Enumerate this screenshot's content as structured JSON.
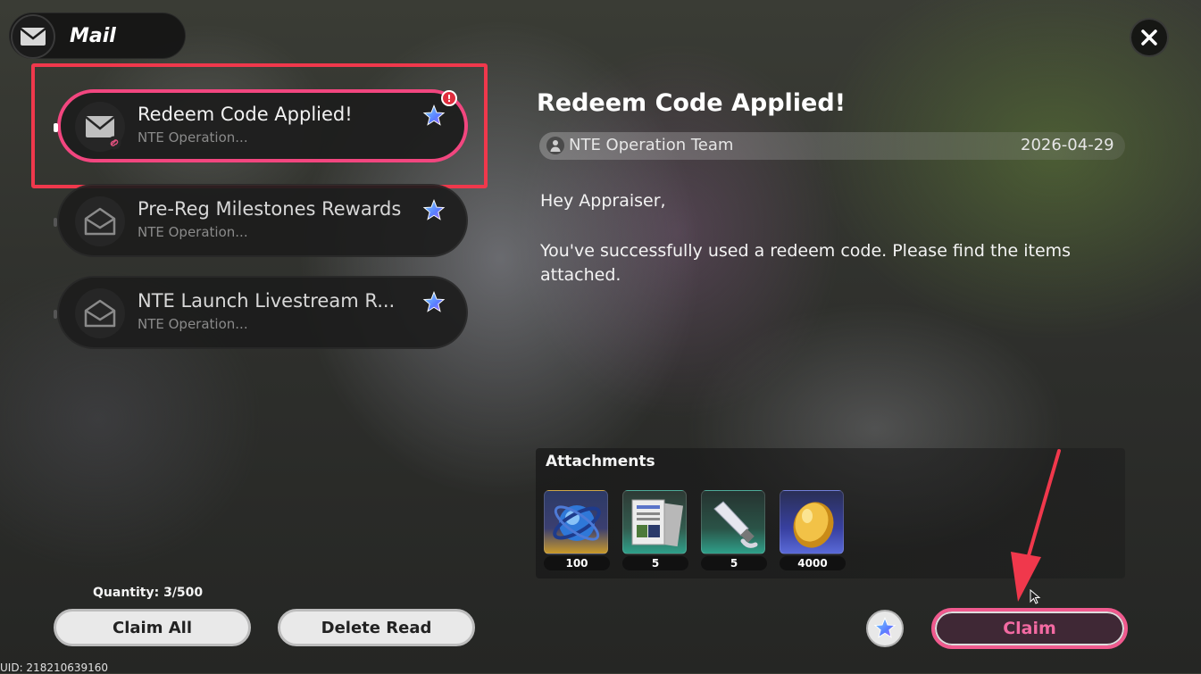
{
  "header": {
    "title": "Mail",
    "icon": "envelope-icon"
  },
  "close": {
    "icon": "close-icon"
  },
  "mail_list": [
    {
      "title": "Redeem Code Applied!",
      "sender": "NTE Operation...",
      "selected": true,
      "unread": true,
      "icon": "envelope-closed-icon",
      "has_link": true
    },
    {
      "title": "Pre-Reg Milestones Rewards",
      "sender": "NTE Operation...",
      "selected": false,
      "unread": false,
      "icon": "envelope-open-icon"
    },
    {
      "title": "NTE Launch Livestream R...",
      "sender": "NTE Operation...",
      "selected": false,
      "unread": false,
      "icon": "envelope-open-icon"
    }
  ],
  "alert_badge": "!",
  "quantity": "Quantity: 3/500",
  "buttons": {
    "claim_all": "Claim All",
    "delete_read": "Delete Read",
    "claim": "Claim"
  },
  "uid": "UID: 218210639160",
  "detail": {
    "title": "Redeem Code Applied!",
    "sender": "NTE Operation Team",
    "date": "2026-04-29",
    "greeting": "Hey Appraiser,",
    "body": "You've successfully used a redeem code. Please find the items attached."
  },
  "attachments": {
    "title": "Attachments",
    "items": [
      {
        "name": "blue-orb-item",
        "qty": "100"
      },
      {
        "name": "document-item",
        "qty": "5"
      },
      {
        "name": "tube-item",
        "qty": "5"
      },
      {
        "name": "gold-coin-item",
        "qty": "4000"
      }
    ]
  },
  "colors": {
    "accent": "#f2467f",
    "highlight": "#f0384c",
    "star": "#5aa8ff"
  }
}
